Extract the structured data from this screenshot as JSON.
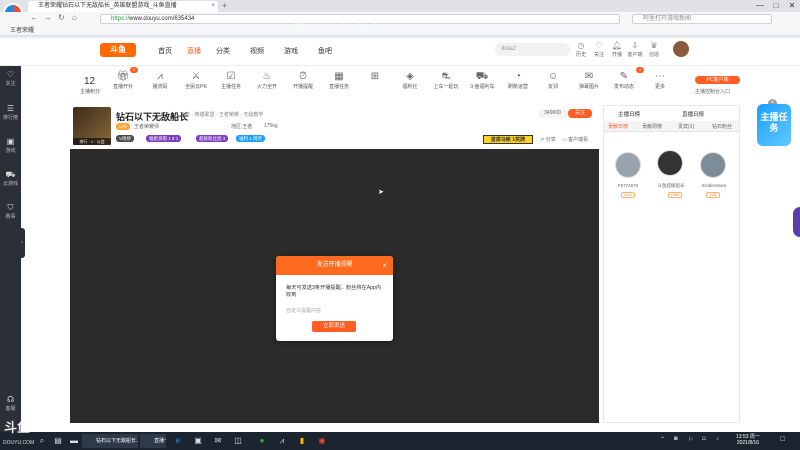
{
  "browser": {
    "tab_title": "王者荣耀钻石以下无敌船长_英雄联盟游戏_斗鱼直播",
    "url_https": "https://",
    "url_rest": "www.douyu.com/635434",
    "search_placeholder": "阿里打开游戏新闻",
    "bookmark": "王者荣耀",
    "watermark": "毒王进入蓝冠",
    "window_controls": [
      "—",
      "□",
      "✕"
    ],
    "nav_icons": [
      "back-icon",
      "forward-icon",
      "refresh-icon",
      "home-icon"
    ]
  },
  "header": {
    "logo": "斗鱼",
    "nav": [
      {
        "label": "首页",
        "active": false
      },
      {
        "label": "直播",
        "active": true
      },
      {
        "label": "分类",
        "active": false
      },
      {
        "label": "视频",
        "active": false
      },
      {
        "label": "游戏",
        "active": false
      },
      {
        "label": "鱼吧",
        "active": false
      }
    ],
    "search_placeholder": "dota2",
    "icons": [
      {
        "icon": "clock-icon",
        "label": "历史"
      },
      {
        "icon": "heart-icon",
        "label": "关注"
      },
      {
        "icon": "bell-icon",
        "label": "开播"
      },
      {
        "icon": "download-icon",
        "label": "客户端"
      },
      {
        "icon": "crown-icon",
        "label": "创造"
      }
    ]
  },
  "left_sidebar": [
    {
      "icon": "heart-icon",
      "label": "关注"
    },
    {
      "icon": "list-icon",
      "label": "排行榜"
    },
    {
      "icon": "game-icon",
      "label": "游戏"
    },
    {
      "icon": "car-icon",
      "label": "云游戏"
    },
    {
      "icon": "shield-icon",
      "label": "赛事"
    },
    {
      "icon": "headset-icon",
      "label": "客服"
    }
  ],
  "activity_bar": {
    "level": "12",
    "level_label": "主播积分",
    "items": [
      {
        "icon": "gift-icon",
        "label": "直播开补"
      },
      {
        "icon": "chart-icon",
        "label": "播流码"
      },
      {
        "icon": "pk-icon",
        "label": "全民云PK"
      },
      {
        "icon": "task-icon",
        "label": "主播任务"
      },
      {
        "icon": "fire-icon",
        "label": "火力全开"
      },
      {
        "icon": "clock-icon",
        "label": "开播提醒"
      },
      {
        "icon": "calendar-icon",
        "label": "直播任务"
      },
      {
        "icon": "gift-box-icon",
        "label": "福利社"
      },
      {
        "icon": "share-icon",
        "label": "上车一起玩"
      },
      {
        "icon": "car-icon",
        "label": "斗鱼福利车"
      },
      {
        "icon": "gauge-icon",
        "label": "刷新运营"
      },
      {
        "icon": "users-icon",
        "label": "友邻"
      },
      {
        "icon": "chat-icon",
        "label": "弹幕图片"
      },
      {
        "icon": "edit-icon",
        "label": "发布动态"
      },
      {
        "icon": "more-icon",
        "label": "更多"
      }
    ],
    "badge_1": "3",
    "badge_2": "4",
    "pc_button": "PC客户端",
    "pc_sub": "主播控制台入口"
  },
  "room": {
    "title": "钻石以下无敌船长",
    "meta": "王者 · 英雄联盟 · 王者荣耀 · 无敌教学",
    "rank_label": "排行 · 1 · 公会",
    "tags": [
      {
        "text": "V周榜",
        "color": "#4a4a4a"
      },
      {
        "text": "福星高照 1 8 1",
        "color": "#7b3fbf"
      },
      {
        "text": "超级粉丝团 3",
        "color": "#7b3fbf"
      },
      {
        "text": "福利 1 周奖",
        "color": "#1aa0ff"
      }
    ],
    "anchor_level": "LV9",
    "anchor_name": "王者荣耀师",
    "location": "地区:王者",
    "weight": "175kg",
    "follow_count": "349000",
    "follow_label": "关注",
    "yellow_label": "首席马帐 1奖牌",
    "share": "分享",
    "client_watch": "客户端看"
  },
  "modal": {
    "title": "发送开播提醒",
    "body": "每天可发送3条开播提醒，粉丝将在App内收到",
    "link": "自定义提醒内容",
    "button": "立即发送"
  },
  "right_panel": {
    "top_tabs": [
      "主播日榜",
      "直播日报"
    ],
    "tabs": [
      {
        "label": "贡献日榜",
        "active": true
      },
      {
        "label": "贡献周榜",
        "active": false
      },
      {
        "label": "贵宾(1)",
        "active": false
      },
      {
        "label": "钻石粉丝",
        "active": false
      }
    ],
    "ranks": [
      {
        "name": "F6774676",
        "badge": "LV10"
      },
      {
        "name": "斗鱼超级船长",
        "badge": "LV40"
      },
      {
        "name": "EndlessSea",
        "badge": "LV8"
      }
    ]
  },
  "widgets": {
    "task": "主播任务"
  },
  "taskbar": {
    "windows": [
      "钻石以下无敌船长...",
      "直播一下"
    ],
    "clock_time": "13:53 周一",
    "clock_date": "2021/8/16",
    "watermark_logo": "斗鱼",
    "watermark_url": "DOUYU.COM"
  }
}
